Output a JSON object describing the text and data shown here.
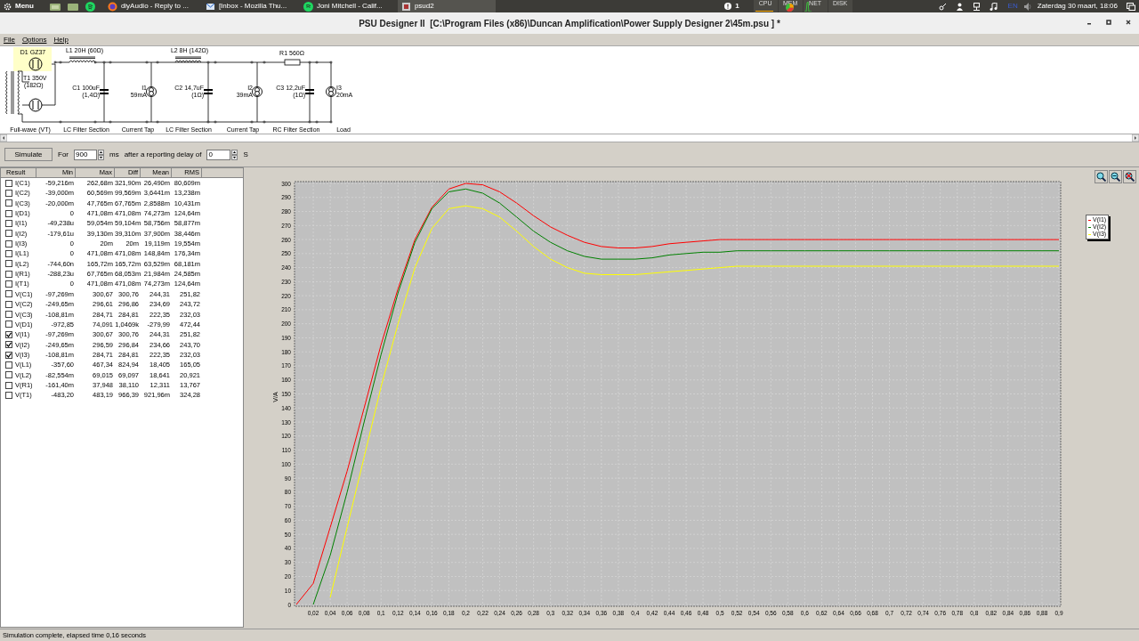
{
  "taskbar": {
    "menu_label": "Menu",
    "tasks": [
      {
        "label": "diyAudio - Reply to ...",
        "selected": false
      },
      {
        "label": "[Inbox - Mozilla Thu...",
        "selected": false
      },
      {
        "label": "Joni Mitchell - Calif...",
        "selected": false
      },
      {
        "label": "psud2",
        "selected": true
      }
    ],
    "notification_count": "1",
    "meters": [
      "CPU",
      "MEM",
      "NET",
      "DISK"
    ],
    "keyboard": "EN",
    "clock": "Zaterdag 30 maart, 18:06"
  },
  "window": {
    "title": "PSU Designer II  [C:\\Program Files (x86)\\Duncan Amplification\\Power Supply Designer 2\\45m.psu ] *"
  },
  "menu": [
    "File",
    "Options",
    "Help"
  ],
  "schematic": {
    "components": [
      {
        "kind": "diode",
        "label": "D1 GZ37",
        "selected": true
      },
      {
        "kind": "transformer",
        "label": "T1 350V",
        "value": "(182Ω)",
        "selected": false
      },
      {
        "kind": "inductor",
        "label": "L1 20H (60Ω)",
        "selected": false
      },
      {
        "kind": "capacitor",
        "label": "C1 100uF",
        "value": "(1,4Ω)",
        "selected": false
      },
      {
        "kind": "current-source",
        "label": "I1",
        "value": "59mA",
        "selected": false
      },
      {
        "kind": "inductor",
        "label": "L2 8H (142Ω)",
        "selected": false
      },
      {
        "kind": "capacitor",
        "label": "C2 14,7uF",
        "value": "(1Ω)",
        "selected": false
      },
      {
        "kind": "current-source",
        "label": "I2",
        "value": "39mA",
        "selected": false
      },
      {
        "kind": "resistor",
        "label": "R1 560Ω",
        "selected": false
      },
      {
        "kind": "capacitor",
        "label": "C3 12,2uF",
        "value": "(1Ω)",
        "selected": false
      },
      {
        "kind": "current-source",
        "label": "I3",
        "value": "20mA",
        "selected": false
      }
    ],
    "sections": [
      "Full-wave (VT)",
      "LC Filter Section",
      "Current Tap",
      "LC Filter Section",
      "Current Tap",
      "RC Filter Section",
      "Load"
    ]
  },
  "toolbar": {
    "simulate_button": "Simulate",
    "for_label": "For",
    "duration": "900",
    "duration_unit": "ms",
    "delay_label": "after a reporting delay of",
    "delay": "0",
    "delay_unit": "S"
  },
  "results": {
    "columns": [
      "Result",
      "Min",
      "Max",
      "Diff",
      "Mean",
      "RMS"
    ],
    "rows": [
      {
        "checked": false,
        "cells": [
          "I(C1)",
          "-59,216m",
          "262,68m",
          "321,90m",
          "26,490m",
          "80,609m"
        ]
      },
      {
        "checked": false,
        "cells": [
          "I(C2)",
          "-39,000m",
          "60,569m",
          "99,569m",
          "3,6441m",
          "13,238m"
        ]
      },
      {
        "checked": false,
        "cells": [
          "I(C3)",
          "-20,000m",
          "47,765m",
          "67,765m",
          "2,8588m",
          "10,431m"
        ]
      },
      {
        "checked": false,
        "cells": [
          "I(D1)",
          "0",
          "471,08m",
          "471,08m",
          "74,273m",
          "124,64m"
        ]
      },
      {
        "checked": false,
        "cells": [
          "I(I1)",
          "-49,238u",
          "59,054m",
          "59,104m",
          "58,756m",
          "58,877m"
        ]
      },
      {
        "checked": false,
        "cells": [
          "I(I2)",
          "-179,61u",
          "39,130m",
          "39,310m",
          "37,900m",
          "38,446m"
        ]
      },
      {
        "checked": false,
        "cells": [
          "I(I3)",
          "0",
          "20m",
          "20m",
          "19,119m",
          "19,554m"
        ]
      },
      {
        "checked": false,
        "cells": [
          "I(L1)",
          "0",
          "471,08m",
          "471,08m",
          "148,84m",
          "176,34m"
        ]
      },
      {
        "checked": false,
        "cells": [
          "I(L2)",
          "-744,60n",
          "165,72m",
          "165,72m",
          "63,529m",
          "68,181m"
        ]
      },
      {
        "checked": false,
        "cells": [
          "I(R1)",
          "-288,23u",
          "67,765m",
          "68,053m",
          "21,984m",
          "24,585m"
        ]
      },
      {
        "checked": false,
        "cells": [
          "I(T1)",
          "0",
          "471,08m",
          "471,08m",
          "74,273m",
          "124,64m"
        ]
      },
      {
        "checked": false,
        "cells": [
          "V(C1)",
          "-97,269m",
          "300,67",
          "300,76",
          "244,31",
          "251,82"
        ]
      },
      {
        "checked": false,
        "cells": [
          "V(C2)",
          "-249,65m",
          "296,61",
          "296,86",
          "234,69",
          "243,72"
        ]
      },
      {
        "checked": false,
        "cells": [
          "V(C3)",
          "-108,81m",
          "284,71",
          "284,81",
          "222,35",
          "232,03"
        ]
      },
      {
        "checked": false,
        "cells": [
          "V(D1)",
          "-972,85",
          "74,091",
          "1,0469k",
          "-279,99",
          "472,44"
        ]
      },
      {
        "checked": true,
        "cells": [
          "V(I1)",
          "-97,269m",
          "300,67",
          "300,76",
          "244,31",
          "251,82"
        ]
      },
      {
        "checked": true,
        "cells": [
          "V(I2)",
          "-249,65m",
          "296,59",
          "296,84",
          "234,66",
          "243,70"
        ]
      },
      {
        "checked": true,
        "cells": [
          "V(I3)",
          "-108,81m",
          "284,71",
          "284,81",
          "222,35",
          "232,03"
        ]
      },
      {
        "checked": false,
        "cells": [
          "V(L1)",
          "-357,60",
          "467,34",
          "824,94",
          "18,405",
          "165,05"
        ]
      },
      {
        "checked": false,
        "cells": [
          "V(L2)",
          "-82,554m",
          "69,015",
          "69,097",
          "18,641",
          "20,921"
        ]
      },
      {
        "checked": false,
        "cells": [
          "V(R1)",
          "-161,40m",
          "37,948",
          "38,110",
          "12,311",
          "13,767"
        ]
      },
      {
        "checked": false,
        "cells": [
          "V(T1)",
          "-483,20",
          "483,19",
          "966,39",
          "921,96m",
          "324,28"
        ]
      }
    ]
  },
  "chart": {
    "chart_data": {
      "type": "line",
      "ylabel": "V/A",
      "grid": true,
      "legend": "right",
      "x": [
        0,
        0.02,
        0.04,
        0.06,
        0.08,
        0.1,
        0.12,
        0.14,
        0.16,
        0.18,
        0.2,
        0.22,
        0.24,
        0.26,
        0.28,
        0.3,
        0.32,
        0.34,
        0.36,
        0.38,
        0.4,
        0.42,
        0.44,
        0.46,
        0.48,
        0.5,
        0.52,
        0.54,
        0.56,
        0.58,
        0.6,
        0.62,
        0.64,
        0.66,
        0.68,
        0.7,
        0.72,
        0.74,
        0.76,
        0.78,
        0.8,
        0.82,
        0.84,
        0.86,
        0.88,
        0.9
      ],
      "series": [
        {
          "name": "V(I1)",
          "color": "#ff0000",
          "values": [
            0,
            15,
            55,
            95,
            140,
            185,
            225,
            260,
            283,
            296,
            300,
            299,
            294,
            286,
            277,
            269,
            263,
            258,
            255,
            254,
            254,
            255,
            257,
            258,
            259,
            260,
            260,
            260,
            260,
            260,
            260,
            260,
            260,
            260,
            260,
            260,
            260,
            260,
            260,
            260,
            260,
            260,
            260,
            260,
            260,
            260
          ]
        },
        {
          "name": "V(I2)",
          "color": "#008000",
          "values": [
            null,
            0,
            35,
            80,
            130,
            178,
            222,
            258,
            282,
            294,
            296,
            293,
            286,
            276,
            266,
            258,
            252,
            248,
            246,
            246,
            246,
            247,
            249,
            250,
            251,
            251,
            252,
            252,
            252,
            252,
            252,
            252,
            252,
            252,
            252,
            252,
            252,
            252,
            252,
            252,
            252,
            252,
            252,
            252,
            252,
            252
          ]
        },
        {
          "name": "V(I3)",
          "color": "#ffff00",
          "values": [
            null,
            null,
            5,
            55,
            105,
            155,
            200,
            240,
            268,
            282,
            284,
            282,
            276,
            266,
            255,
            246,
            240,
            236,
            235,
            235,
            235,
            236,
            237,
            238,
            239,
            240,
            241,
            241,
            241,
            241,
            241,
            241,
            241,
            241,
            241,
            241,
            241,
            241,
            241,
            241,
            241,
            241,
            241,
            241,
            241,
            241
          ]
        }
      ],
      "xlim": [
        0,
        0.9
      ],
      "ylim": [
        0,
        300
      ],
      "xticks": [
        {
          "value": 0.02,
          "label": "0,02"
        },
        {
          "value": 0.04,
          "label": "0,04"
        },
        {
          "value": 0.06,
          "label": "0,06"
        },
        {
          "value": 0.08,
          "label": "0,08"
        },
        {
          "value": 0.1,
          "label": "0,1"
        },
        {
          "value": 0.12,
          "label": "0,12"
        },
        {
          "value": 0.14,
          "label": "0,14"
        },
        {
          "value": 0.16,
          "label": "0,16"
        },
        {
          "value": 0.18,
          "label": "0,18"
        },
        {
          "value": 0.2,
          "label": "0,2"
        },
        {
          "value": 0.22,
          "label": "0,22"
        },
        {
          "value": 0.24,
          "label": "0,24"
        },
        {
          "value": 0.26,
          "label": "0,26"
        },
        {
          "value": 0.28,
          "label": "0,28"
        },
        {
          "value": 0.3,
          "label": "0,3"
        },
        {
          "value": 0.32,
          "label": "0,32"
        },
        {
          "value": 0.34,
          "label": "0,34"
        },
        {
          "value": 0.36,
          "label": "0,36"
        },
        {
          "value": 0.38,
          "label": "0,38"
        },
        {
          "value": 0.4,
          "label": "0,4"
        },
        {
          "value": 0.42,
          "label": "0,42"
        },
        {
          "value": 0.44,
          "label": "0,44"
        },
        {
          "value": 0.46,
          "label": "0,46"
        },
        {
          "value": 0.48,
          "label": "0,48"
        },
        {
          "value": 0.5,
          "label": "0,5"
        },
        {
          "value": 0.52,
          "label": "0,52"
        },
        {
          "value": 0.54,
          "label": "0,54"
        },
        {
          "value": 0.56,
          "label": "0,56"
        },
        {
          "value": 0.58,
          "label": "0,58"
        },
        {
          "value": 0.6,
          "label": "0,6"
        },
        {
          "value": 0.62,
          "label": "0,62"
        },
        {
          "value": 0.64,
          "label": "0,64"
        },
        {
          "value": 0.66,
          "label": "0,66"
        },
        {
          "value": 0.68,
          "label": "0,68"
        },
        {
          "value": 0.7,
          "label": "0,7"
        },
        {
          "value": 0.72,
          "label": "0,72"
        },
        {
          "value": 0.74,
          "label": "0,74"
        },
        {
          "value": 0.76,
          "label": "0,76"
        },
        {
          "value": 0.78,
          "label": "0,78"
        },
        {
          "value": 0.8,
          "label": "0,8"
        },
        {
          "value": 0.82,
          "label": "0,82"
        },
        {
          "value": 0.84,
          "label": "0,84"
        },
        {
          "value": 0.86,
          "label": "0,86"
        },
        {
          "value": 0.88,
          "label": "0,88"
        },
        {
          "value": 0.9,
          "label": "0,9"
        }
      ],
      "yticks": [
        0,
        10,
        20,
        30,
        40,
        50,
        60,
        70,
        80,
        90,
        100,
        110,
        120,
        130,
        140,
        150,
        160,
        170,
        180,
        190,
        200,
        210,
        220,
        230,
        240,
        250,
        260,
        270,
        280,
        290,
        300
      ]
    }
  },
  "status_bar": "Simulation complete, elapsed time 0,16 seconds"
}
